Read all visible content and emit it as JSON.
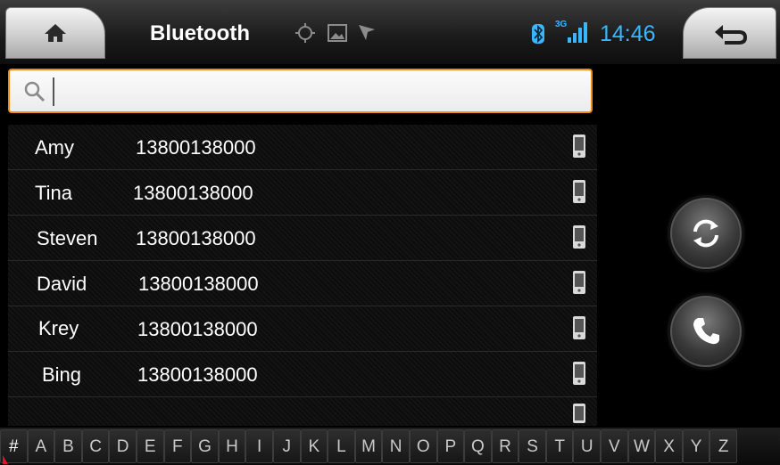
{
  "header": {
    "title": "Bluetooth",
    "clock": "14:46",
    "signal_label": "3G"
  },
  "search": {
    "value": "",
    "placeholder": ""
  },
  "contacts": [
    {
      "name": "Amy",
      "number": "13800138000"
    },
    {
      "name": "Tina",
      "number": "13800138000"
    },
    {
      "name": "Steven",
      "number": "13800138000"
    },
    {
      "name": "David",
      "number": "13800138000"
    },
    {
      "name": "Krey",
      "number": "13800138000"
    },
    {
      "name": "Bing",
      "number": "13800138000"
    }
  ],
  "alphabet": [
    "#",
    "A",
    "B",
    "C",
    "D",
    "E",
    "F",
    "G",
    "H",
    "I",
    "J",
    "K",
    "L",
    "M",
    "N",
    "O",
    "P",
    "Q",
    "R",
    "S",
    "T",
    "U",
    "V",
    "W",
    "X",
    "Y",
    "Z"
  ],
  "colors": {
    "accent_orange": "#f08a1b",
    "status_blue": "#38b6ff",
    "marker_red": "#e0161e"
  },
  "icons": {
    "home": "home-icon",
    "back": "back-arrow-icon",
    "gps": "crosshair-icon",
    "picture": "picture-icon",
    "navigation": "navigation-arrow-icon",
    "bluetooth": "bluetooth-icon",
    "signal": "signal-icon",
    "search": "search-icon",
    "phone": "mobile-phone-icon",
    "sync": "sync-icon",
    "call": "call-icon"
  }
}
